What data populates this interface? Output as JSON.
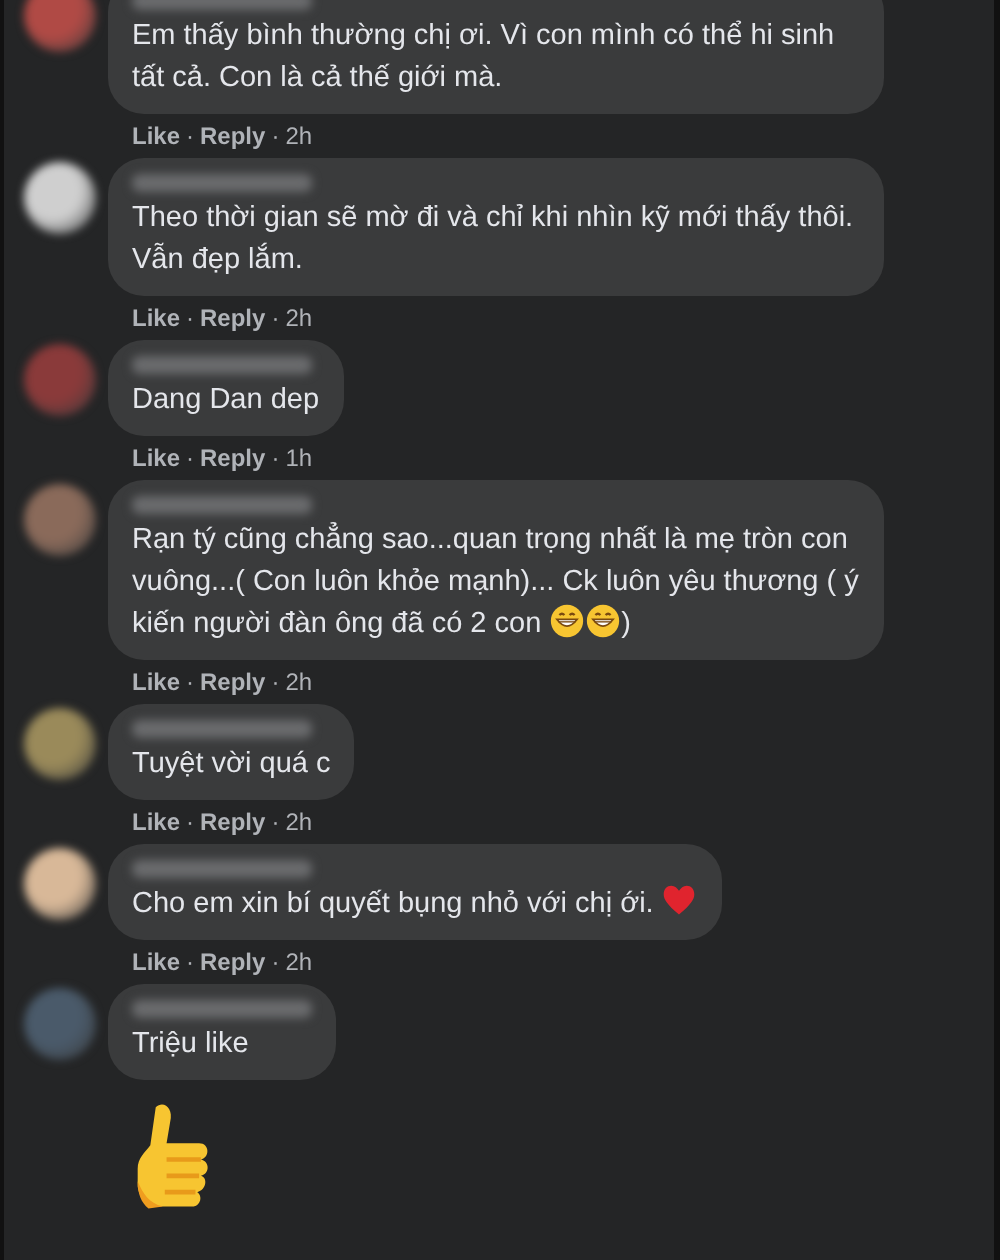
{
  "comments": [
    {
      "avatar": {
        "color": "#b04a45"
      },
      "body": [
        {
          "kind": "text",
          "text": "Em thấy bình thường chị ơi. Vì con mình có thể hi sinh tất cả. Con là cả thế giới mà."
        }
      ],
      "actions": {
        "like": "Like",
        "separator": "·",
        "reply": "Reply",
        "time": "2h"
      }
    },
    {
      "avatar": {
        "color": "#cfcfcf"
      },
      "body": [
        {
          "kind": "text",
          "text": "Theo thời gian sẽ mờ đi và chỉ khi nhìn kỹ mới thấy thôi. Vẫn đẹp lắm."
        }
      ],
      "actions": {
        "like": "Like",
        "separator": "·",
        "reply": "Reply",
        "time": "2h"
      }
    },
    {
      "avatar": {
        "color": "#8a3a3a"
      },
      "body": [
        {
          "kind": "text",
          "text": "Dang Dan dep"
        }
      ],
      "actions": {
        "like": "Like",
        "separator": "·",
        "reply": "Reply",
        "time": "1h"
      }
    },
    {
      "avatar": {
        "color": "#8a6a5a"
      },
      "body": [
        {
          "kind": "text",
          "text": "Rạn tý cũng chẳng sao...quan trọng nhất là mẹ tròn con vuông...( Con luôn khỏe mạnh)... Ck luôn yêu thương ( ý kiến người đàn ông đã có 2 con "
        },
        {
          "kind": "grin"
        },
        {
          "kind": "grin"
        },
        {
          "kind": "text",
          "text": ")"
        }
      ],
      "actions": {
        "like": "Like",
        "separator": "·",
        "reply": "Reply",
        "time": "2h"
      }
    },
    {
      "avatar": {
        "color": "#9a8a5a"
      },
      "body": [
        {
          "kind": "text",
          "text": "Tuyệt vời quá c"
        }
      ],
      "actions": {
        "like": "Like",
        "separator": "·",
        "reply": "Reply",
        "time": "2h"
      }
    },
    {
      "avatar": {
        "color": "#d8b898"
      },
      "body": [
        {
          "kind": "text",
          "text": "Cho em xin bí quyết bụng nhỏ với chị ới. "
        },
        {
          "kind": "heart"
        }
      ],
      "actions": {
        "like": "Like",
        "separator": "·",
        "reply": "Reply",
        "time": "2h"
      }
    },
    {
      "avatar": {
        "color": "#4a5a6a"
      },
      "body": [
        {
          "kind": "text",
          "text": "Triệu like"
        }
      ],
      "attachment": {
        "kind": "thumbs"
      }
    }
  ]
}
